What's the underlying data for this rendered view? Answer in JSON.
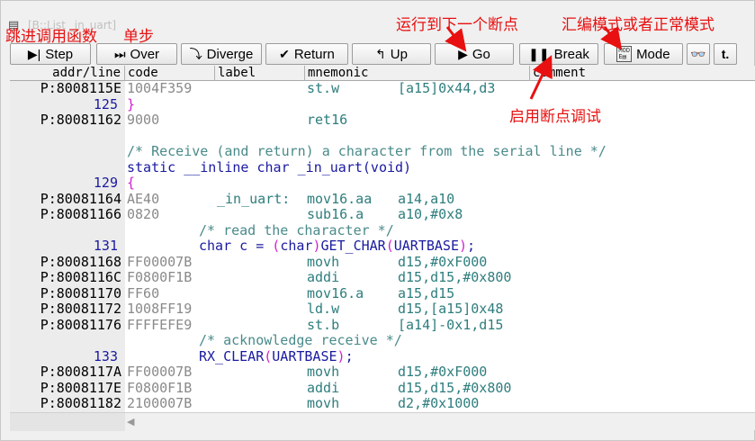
{
  "window": {
    "title": "[B::List _in_uart]"
  },
  "toolbar": {
    "buttons": [
      {
        "label": "Step",
        "icon": "step-into-icon",
        "glyph": "▶|"
      },
      {
        "label": "Over",
        "icon": "step-over-icon",
        "glyph": "▶"
      },
      {
        "label": "Diverge",
        "icon": "diverge-icon",
        "glyph": "⤵"
      },
      {
        "label": "Return",
        "icon": "return-icon",
        "glyph": "✔"
      },
      {
        "label": "Up",
        "icon": "up-icon",
        "glyph": "↰"
      },
      {
        "label": "Go",
        "icon": "go-icon",
        "glyph": "▶"
      },
      {
        "label": "Break",
        "icon": "break-icon",
        "glyph": "❚❚"
      },
      {
        "label": "Mode",
        "icon": "mode-icon",
        "glyph": "MOD"
      },
      {
        "label": "",
        "icon": "glasses-icon",
        "glyph": "👓"
      },
      {
        "label": "",
        "icon": "up-arrow-icon",
        "glyph": "t."
      }
    ]
  },
  "columns": [
    "addr/line",
    "code",
    "label",
    "mnemonic",
    "comment"
  ],
  "rows": [
    {
      "type": "asm",
      "addr": "P:8008115E",
      "code": "1004F359",
      "label": "",
      "mnemonic": "st.w",
      "operands": "[a15]0x44,d3"
    },
    {
      "type": "line",
      "line": "125",
      "brace": "}"
    },
    {
      "type": "asm",
      "addr": "P:80081162",
      "code": "9000",
      "label": "",
      "mnemonic": "ret16",
      "operands": ""
    },
    {
      "type": "blank"
    },
    {
      "type": "comment",
      "text": "/* Receive (and return) a character from the serial line */",
      "indent": 0
    },
    {
      "type": "src",
      "text": "static __inline char _in_uart(void)",
      "indent": 0
    },
    {
      "type": "line",
      "line": "129",
      "brace": "{"
    },
    {
      "type": "asm",
      "addr": "P:80081164",
      "code": "AE40",
      "label": "_in_uart:",
      "mnemonic": "mov16.aa",
      "operands": "a14,a10"
    },
    {
      "type": "asm",
      "addr": "P:80081166",
      "code": "0820",
      "label": "",
      "mnemonic": "sub16.a",
      "operands": "a10,#0x8"
    },
    {
      "type": "comment",
      "text": "/* read the character */",
      "indent": 1
    },
    {
      "type": "srcline",
      "line": "131",
      "pre": "char c = ",
      "paren1": "(",
      "mid": "char",
      "paren2": ")",
      "post": "GET_CHAR",
      "paren3": "(",
      "arg": "UARTBASE",
      "paren4": ")",
      "end": ";"
    },
    {
      "type": "asm",
      "addr": "P:80081168",
      "code": "FF00007B",
      "label": "",
      "mnemonic": "movh",
      "operands": "d15,#0xF000"
    },
    {
      "type": "asm",
      "addr": "P:8008116C",
      "code": "F0800F1B",
      "label": "",
      "mnemonic": "addi",
      "operands": "d15,d15,#0x800"
    },
    {
      "type": "asm",
      "addr": "P:80081170",
      "code": "FF60",
      "label": "",
      "mnemonic": "mov16.a",
      "operands": "a15,d15"
    },
    {
      "type": "asm",
      "addr": "P:80081172",
      "code": "1008FF19",
      "label": "",
      "mnemonic": "ld.w",
      "operands": "d15,[a15]0x48"
    },
    {
      "type": "asm",
      "addr": "P:80081176",
      "code": "FFFFEFE9",
      "label": "",
      "mnemonic": "st.b",
      "operands": "[a14]-0x1,d15"
    },
    {
      "type": "comment",
      "text": "/* acknowledge receive */",
      "indent": 1
    },
    {
      "type": "srcline2",
      "line": "133",
      "pre": "RX_CLEAR",
      "paren1": "(",
      "arg": "UARTBASE",
      "paren2": ")",
      "end": ";"
    },
    {
      "type": "asm",
      "addr": "P:8008117A",
      "code": "FF00007B",
      "label": "",
      "mnemonic": "movh",
      "operands": "d15,#0xF000"
    },
    {
      "type": "asm",
      "addr": "P:8008117E",
      "code": "F0800F1B",
      "label": "",
      "mnemonic": "addi",
      "operands": "d15,d15,#0x800"
    },
    {
      "type": "asm",
      "addr": "P:80081182",
      "code": "2100007B",
      "label": "",
      "mnemonic": "movh",
      "operands": "d2,#0x1000"
    }
  ],
  "annotations": {
    "step_over": "跳进调用函数",
    "single_step": "单步",
    "go": "运行到下一个断点",
    "mode": "汇编模式或者正常模式",
    "break": "启用断点调试"
  },
  "colors": {
    "annotation": "#e81010",
    "source": "#1a1aa0",
    "mnemonic": "#2e7d7d",
    "brace": "#d020d0",
    "code_hex": "#8a8a8a"
  }
}
